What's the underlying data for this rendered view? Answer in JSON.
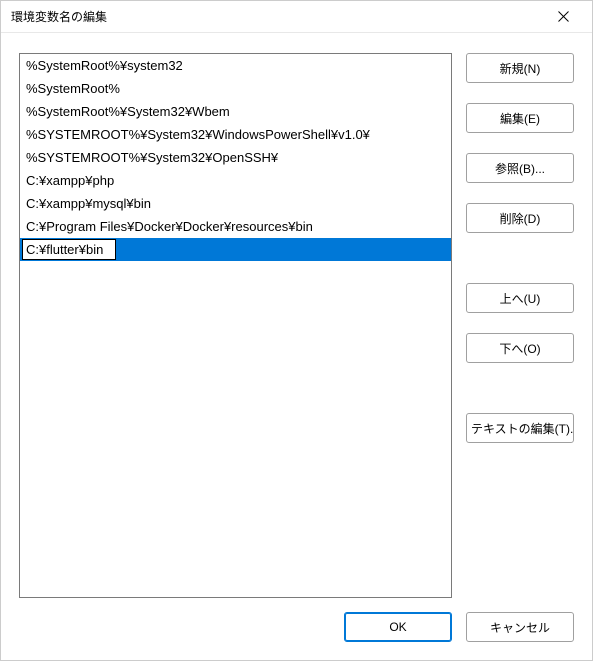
{
  "window": {
    "title": "環境変数名の編集"
  },
  "pathEntries": [
    {
      "value": "%SystemRoot%¥system32",
      "selected": false,
      "editing": false
    },
    {
      "value": "%SystemRoot%",
      "selected": false,
      "editing": false
    },
    {
      "value": "%SystemRoot%¥System32¥Wbem",
      "selected": false,
      "editing": false
    },
    {
      "value": "%SYSTEMROOT%¥System32¥WindowsPowerShell¥v1.0¥",
      "selected": false,
      "editing": false
    },
    {
      "value": "%SYSTEMROOT%¥System32¥OpenSSH¥",
      "selected": false,
      "editing": false
    },
    {
      "value": "C:¥xampp¥php",
      "selected": false,
      "editing": false
    },
    {
      "value": "C:¥xampp¥mysql¥bin",
      "selected": false,
      "editing": false
    },
    {
      "value": "C:¥Program Files¥Docker¥Docker¥resources¥bin",
      "selected": false,
      "editing": false
    },
    {
      "value": "C:¥flutter¥bin",
      "selected": true,
      "editing": true
    }
  ],
  "buttons": {
    "new": "新規(N)",
    "edit": "編集(E)",
    "browse": "参照(B)...",
    "delete": "削除(D)",
    "moveUp": "上へ(U)",
    "moveDown": "下へ(O)",
    "editText": "テキストの編集(T)...",
    "ok": "OK",
    "cancel": "キャンセル"
  }
}
